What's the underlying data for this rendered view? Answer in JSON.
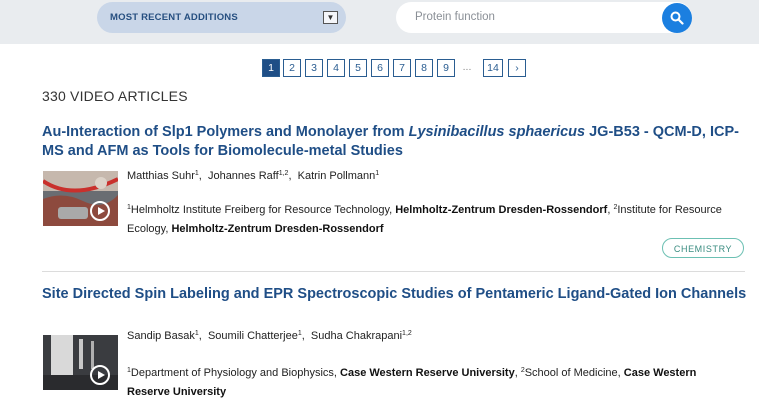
{
  "filter": {
    "sort_label": "MOST RECENT ADDITIONS",
    "search_placeholder": "Protein function"
  },
  "pagination": {
    "pages": [
      "1",
      "2",
      "3",
      "4",
      "5",
      "6",
      "7",
      "8",
      "9"
    ],
    "ellipsis": "...",
    "last": "14",
    "next": "›",
    "active": "1"
  },
  "results": {
    "count_label": "330 VIDEO ARTICLES"
  },
  "articles": [
    {
      "title_pre": "Au-Interaction of Slp1 Polymers and Monolayer from ",
      "title_italic": "Lysinibacillus sphaericus",
      "title_post": " JG-B53 - QCM-D, ICP-MS and AFM as Tools for Biomolecule-metal Studies",
      "authors": [
        {
          "name": "Matthias Suhr",
          "sup": "1"
        },
        {
          "name": "Johannes Raff",
          "sup": "1,2"
        },
        {
          "name": "Katrin Pollmann",
          "sup": "1"
        }
      ],
      "affiliations": [
        {
          "sup": "1",
          "text": "Helmholtz Institute Freiberg for Resource Technology, ",
          "bold": "Helmholtz-Zentrum Dresden-Rossendorf"
        },
        {
          "sup": "2",
          "text": "Institute for Resource Ecology, ",
          "bold": "Helmholtz-Zentrum Dresden-Rossendorf"
        }
      ],
      "tag": "CHEMISTRY"
    },
    {
      "title": "Site Directed Spin Labeling and EPR Spectroscopic Studies of Pentameric Ligand-Gated Ion Channels",
      "authors": [
        {
          "name": "Sandip Basak",
          "sup": "1"
        },
        {
          "name": "Soumili Chatterjee",
          "sup": "1"
        },
        {
          "name": "Sudha Chakrapani",
          "sup": "1,2"
        }
      ],
      "affiliations": [
        {
          "sup": "1",
          "text": "Department of Physiology and Biophysics, ",
          "bold": "Case Western Reserve University"
        },
        {
          "sup": "2",
          "text": "School of Medicine, ",
          "bold": "Case Western Reserve University"
        }
      ]
    }
  ],
  "colors": {
    "link": "#1f4e86",
    "accent": "#1b7fe0",
    "tag_border": "#6cc0b3"
  }
}
